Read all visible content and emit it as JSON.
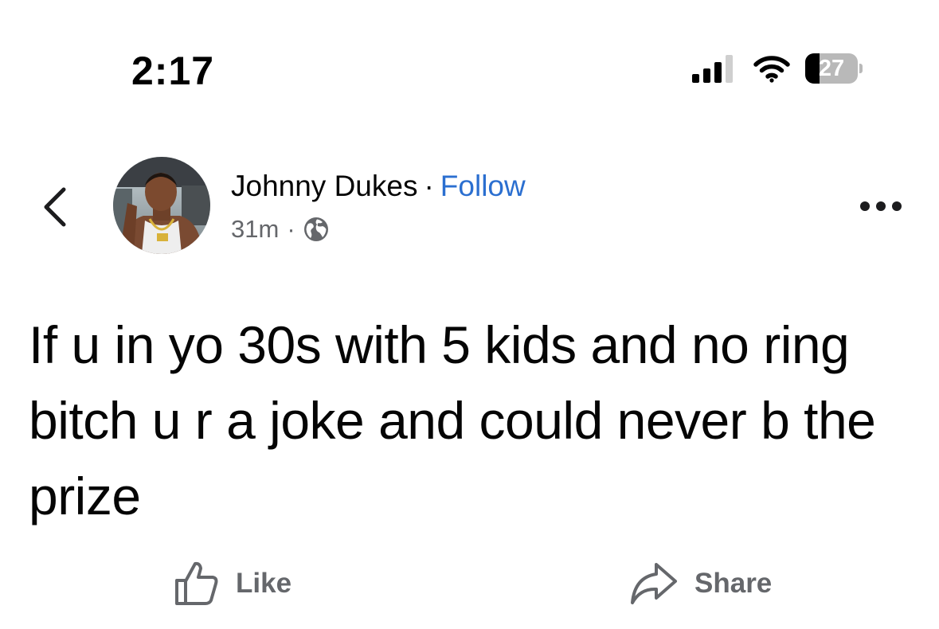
{
  "status_bar": {
    "time": "2:17",
    "battery_percent": "27",
    "battery_level": 0.27,
    "signal_bars_active": 3,
    "icons": [
      "cellular-signal-icon",
      "wifi-icon",
      "battery-icon"
    ]
  },
  "post_header": {
    "back_icon": "chevron-left-icon",
    "author_name": "Johnny Dukes",
    "separator": "·",
    "follow_label": "Follow",
    "timestamp": "31m",
    "meta_separator": "·",
    "audience_icon": "globe-icon",
    "more_icon": "ellipsis-icon"
  },
  "post": {
    "text": "If u in yo 30s with 5 kids and no ring bitch u r a joke and could never b the prize"
  },
  "actions": {
    "like_label": "Like",
    "like_icon": "thumbs-up-icon",
    "share_label": "Share",
    "share_icon": "share-arrow-icon"
  },
  "colors": {
    "follow_link": "#2b6fd0",
    "secondary_text": "#65676b",
    "primary_text": "#050505",
    "background": "#ffffff"
  }
}
